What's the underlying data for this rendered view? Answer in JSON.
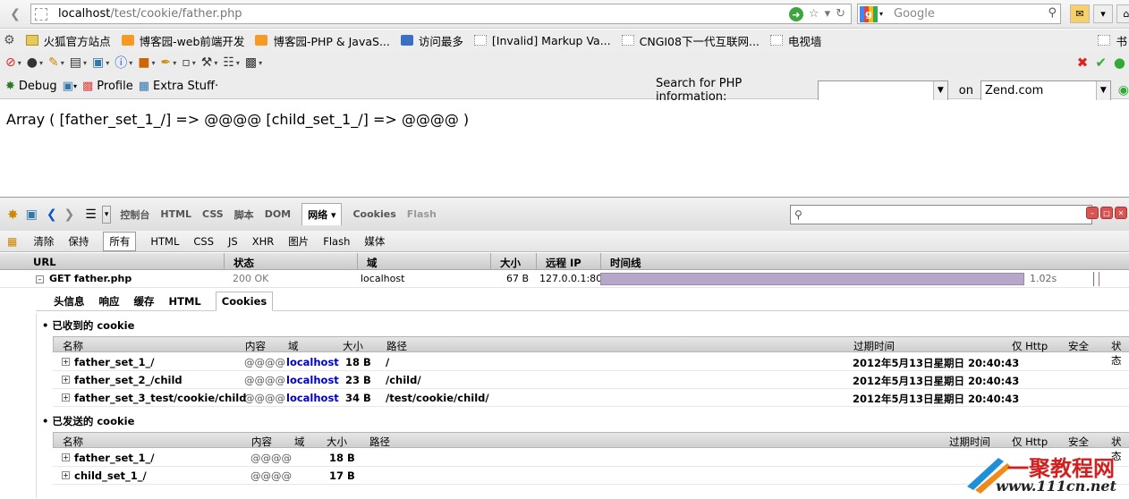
{
  "nav": {
    "back_icon": "back-arrow-icon",
    "url_host": "localhost",
    "url_path": "/test/cookie/father.php",
    "search_placeholder": "Google"
  },
  "bookmarks": [
    {
      "label": "火狐官方站点",
      "icon": "folder"
    },
    {
      "label": "博客园-web前端开发",
      "icon": "rss"
    },
    {
      "label": "博客园-PHP & JavaS...",
      "icon": "rss"
    },
    {
      "label": "访问最多",
      "icon": "blue"
    },
    {
      "label": "[Invalid] Markup Va...",
      "icon": "page"
    },
    {
      "label": "CNGI08下一代互联网...",
      "icon": "page"
    },
    {
      "label": "电视墙",
      "icon": "page"
    }
  ],
  "bookmark_end": "书",
  "debugbar": {
    "debug": "Debug",
    "profile": "Profile",
    "extra": "Extra Stuff·",
    "search_label": "Search for PHP information:",
    "on_label": "on",
    "site_value": "Zend.com"
  },
  "content": {
    "output": "Array ( [father_set_1_/] => @@@@ [child_set_1_/] => @@@@ )"
  },
  "firebug": {
    "tabs": [
      "控制台",
      "HTML",
      "CSS",
      "脚本",
      "DOM",
      "网络 ▾",
      "Cookies",
      "Flash"
    ],
    "filters": [
      "清除",
      "保持",
      "所有",
      "HTML",
      "CSS",
      "JS",
      "XHR",
      "图片",
      "Flash",
      "媒体"
    ],
    "columns": [
      "URL",
      "状态",
      "域",
      "大小",
      "远程 IP",
      "时间线"
    ],
    "request": {
      "method_url": "GET father.php",
      "status": "200 OK",
      "domain": "localhost",
      "size": "67 B",
      "ip": "127.0.0.1:80",
      "time": "1.02s",
      "timeline_fraction": 0.9
    },
    "detail_tabs": [
      "头信息",
      "响应",
      "缓存",
      "HTML",
      "Cookies"
    ],
    "received": {
      "title": "已收到的 cookie",
      "headers": [
        "名称",
        "内容",
        "域",
        "大小",
        "路径",
        "过期时间",
        "仅 Http",
        "安全",
        "状态"
      ],
      "rows": [
        {
          "name": "father_set_1_/",
          "content": "@@@@",
          "domain": "localhost",
          "size": "18 B",
          "path": "/",
          "expires": "2012年5月13日星期日 20:40:43"
        },
        {
          "name": "father_set_2_/child",
          "content": "@@@@",
          "domain": "localhost",
          "size": "23 B",
          "path": "/child/",
          "expires": "2012年5月13日星期日 20:40:43"
        },
        {
          "name": "father_set_3_test/cookie/child",
          "content": "@@@@",
          "domain": "localhost",
          "size": "34 B",
          "path": "/test/cookie/child/",
          "expires": "2012年5月13日星期日 20:40:43"
        }
      ]
    },
    "sent": {
      "title": "已发送的 cookie",
      "headers": [
        "名称",
        "内容",
        "域",
        "大小",
        "路径",
        "过期时间",
        "仅 Http",
        "安全",
        "状态"
      ],
      "rows": [
        {
          "name": "father_set_1_/",
          "content": "@@@@",
          "size": "18 B"
        },
        {
          "name": "child_set_1_/",
          "content": "@@@@",
          "size": "17 B"
        }
      ]
    }
  },
  "watermark": {
    "line1": "一聚教程网",
    "line2": "www.111cn.net"
  },
  "colors": {
    "timeline": "#b6a6c8",
    "domain_link": "#0000d0",
    "watermark_red": "#d02020"
  }
}
